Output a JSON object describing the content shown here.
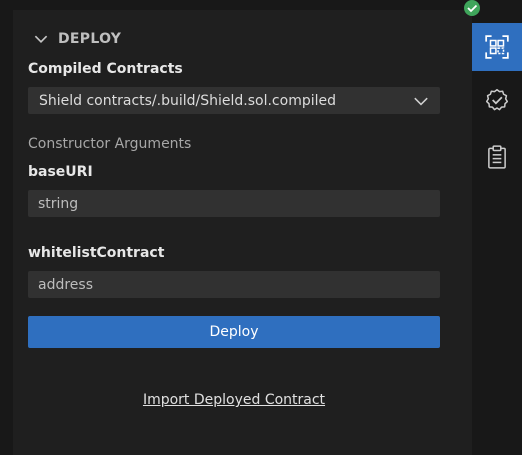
{
  "deploy_section": {
    "title": "DEPLOY",
    "compiled_contracts_label": "Compiled Contracts",
    "selected_contract": "Shield contracts/.build/Shield.sol.compiled",
    "constructor_arguments_label": "Constructor Arguments",
    "arguments": [
      {
        "name": "baseURI",
        "placeholder": "string"
      },
      {
        "name": "whitelistContract",
        "placeholder": "address"
      }
    ],
    "deploy_button_label": "Deploy",
    "import_link_label": "Import Deployed Contract"
  },
  "activity_bar": {
    "items": [
      {
        "icon": "contract-blocks-icon",
        "active": true
      },
      {
        "icon": "verified-badge-icon",
        "active": false
      },
      {
        "icon": "clipboard-icon",
        "active": false
      }
    ]
  },
  "colors": {
    "accent": "#2f6fbf",
    "panel_bg": "#1f1f1f",
    "input_bg": "#313131",
    "badge_green": "#3fa55b"
  }
}
